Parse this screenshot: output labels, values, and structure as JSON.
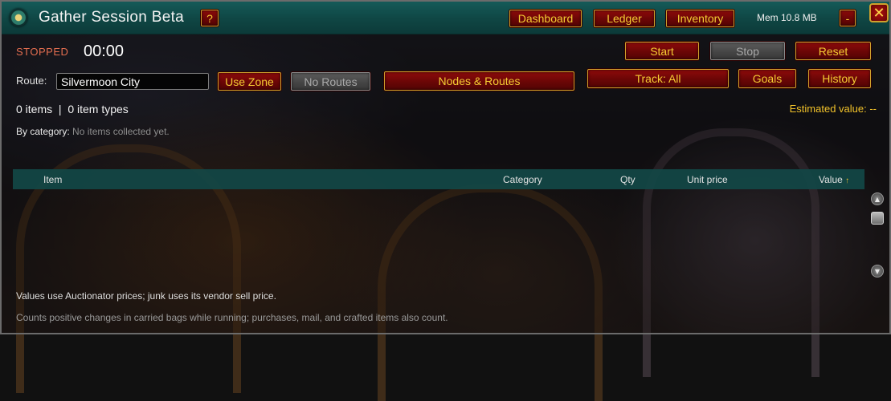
{
  "window": {
    "title": "Gather Session Beta",
    "help_label": "?",
    "mem_label": "Mem 10.8 MB",
    "minimize_label": "-",
    "close_label": "✕"
  },
  "nav": {
    "dashboard": "Dashboard",
    "ledger": "Ledger",
    "inventory": "Inventory"
  },
  "session": {
    "status": "STOPPED",
    "timer": "00:00",
    "start": "Start",
    "stop": "Stop",
    "reset": "Reset"
  },
  "route": {
    "label": "Route:",
    "value": "Silvermoon City",
    "use_zone": "Use Zone",
    "no_routes": "No Routes",
    "nodes_routes": "Nodes & Routes"
  },
  "tracking": {
    "track": "Track: All",
    "goals": "Goals",
    "history": "History"
  },
  "summary": {
    "counts": "0 items  |  0 item types",
    "estimated": "Estimated value: --",
    "by_category_label": "By category:",
    "by_category_value": "No items collected yet."
  },
  "table": {
    "columns": [
      "Item",
      "Category",
      "Qty",
      "Unit price",
      "Value"
    ],
    "sort_indicator": "↑"
  },
  "footer": {
    "note1": "Values use Auctionator prices; junk uses its vendor sell price.",
    "note2": "Counts positive changes in carried bags while running; purchases, mail, and crafted items also count."
  },
  "colors": {
    "titlebar": "#155a58",
    "button_red": "#7a0808",
    "button_text": "#f5cc33",
    "status_stopped": "#e46e50",
    "estimated": "#f2c22a"
  }
}
